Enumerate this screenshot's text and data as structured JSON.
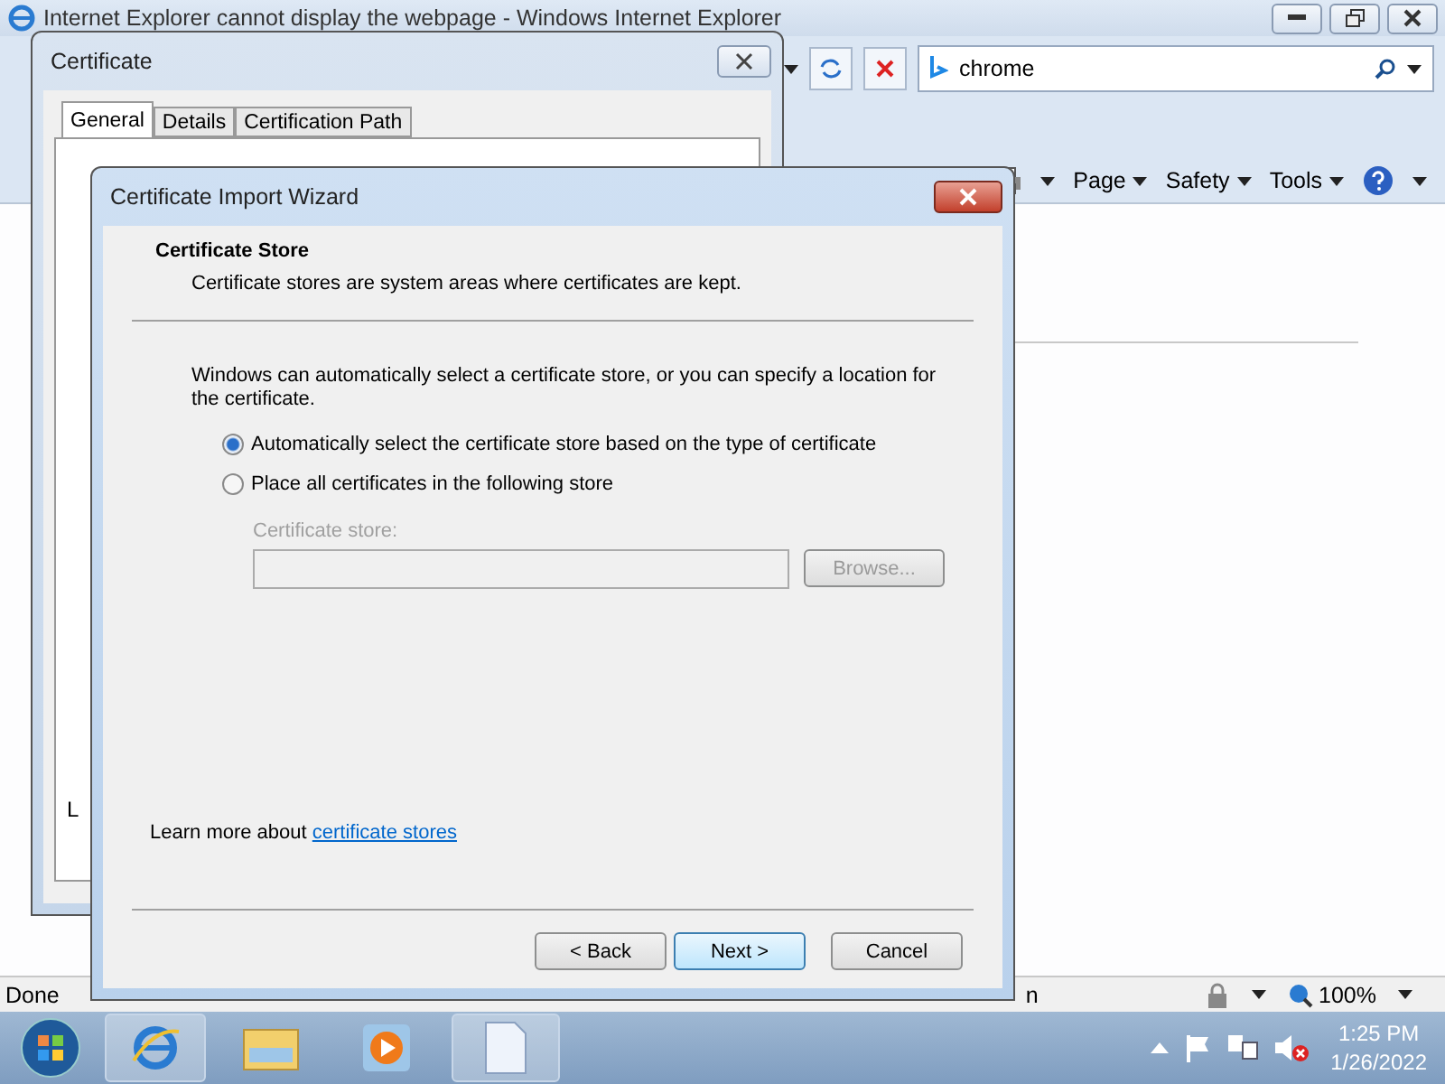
{
  "browser": {
    "title": "Internet Explorer cannot display the webpage - Windows Internet Explorer",
    "search": {
      "value": "chrome"
    },
    "commands": [
      {
        "label": "Page"
      },
      {
        "label": "Safety"
      },
      {
        "label": "Tools"
      }
    ],
    "status_bar": {
      "text": "Done",
      "text_tail": "n",
      "zoom": "100%"
    }
  },
  "certificate_dialog": {
    "title": "Certificate",
    "tabs": [
      {
        "label": "General",
        "selected": true
      },
      {
        "label": "Details",
        "selected": false
      },
      {
        "label": "Certification Path",
        "selected": false
      }
    ],
    "partial_text": "L"
  },
  "wizard": {
    "title": "Certificate Import Wizard",
    "heading": "Certificate Store",
    "subheading": "Certificate stores are system areas where certificates are kept.",
    "description": "Windows can automatically select a certificate store, or you can specify a location for the certificate.",
    "options": [
      {
        "label": "Automatically select the certificate store based on the type of certificate",
        "selected": true
      },
      {
        "label": "Place all certificates in the following store",
        "selected": false
      }
    ],
    "store_label": "Certificate store:",
    "store_field": {
      "disabled": true
    },
    "browse_button": {
      "label": "Browse...",
      "disabled": true
    },
    "learn_more": {
      "text": "Learn more about ",
      "link": "certificate stores"
    },
    "buttons": [
      {
        "label": "< Back",
        "default": false
      },
      {
        "label": "Next >",
        "default": true
      },
      {
        "label": "Cancel",
        "default": false
      }
    ]
  },
  "taskbar": {
    "time": "1:25 PM",
    "date": "1/26/2022"
  }
}
